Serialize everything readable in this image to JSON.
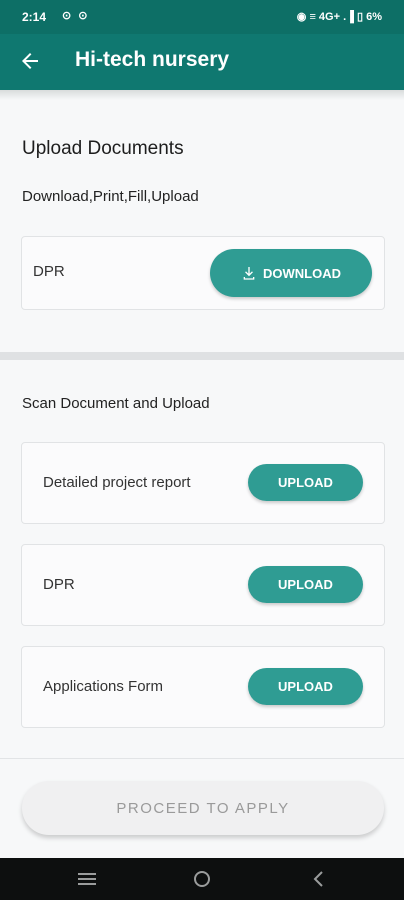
{
  "status_bar": {
    "time": "2:14",
    "left_icons": "⊙ ⊙",
    "right_text": "◉ ≡ 4G+ .▐ ▯ 6%"
  },
  "app_bar": {
    "title": "Hi-tech nursery"
  },
  "upload_documents": {
    "title": "Upload Documents",
    "subtitle": "Download,Print,Fill,Upload",
    "download_card": {
      "label": "DPR",
      "button_label": "DOWNLOAD"
    }
  },
  "scan_section": {
    "title": "Scan Document and Upload",
    "items": [
      {
        "label": "Detailed project report",
        "button_label": "UPLOAD"
      },
      {
        "label": "DPR",
        "button_label": "UPLOAD"
      },
      {
        "label": "Applications Form",
        "button_label": "UPLOAD"
      }
    ]
  },
  "footer": {
    "proceed_label": "PROCEED TO APPLY"
  },
  "colors": {
    "primary_dark": "#0d6f66",
    "primary": "#0f7870",
    "button": "#2f9c93",
    "disabled_text": "#9a9a9a"
  }
}
